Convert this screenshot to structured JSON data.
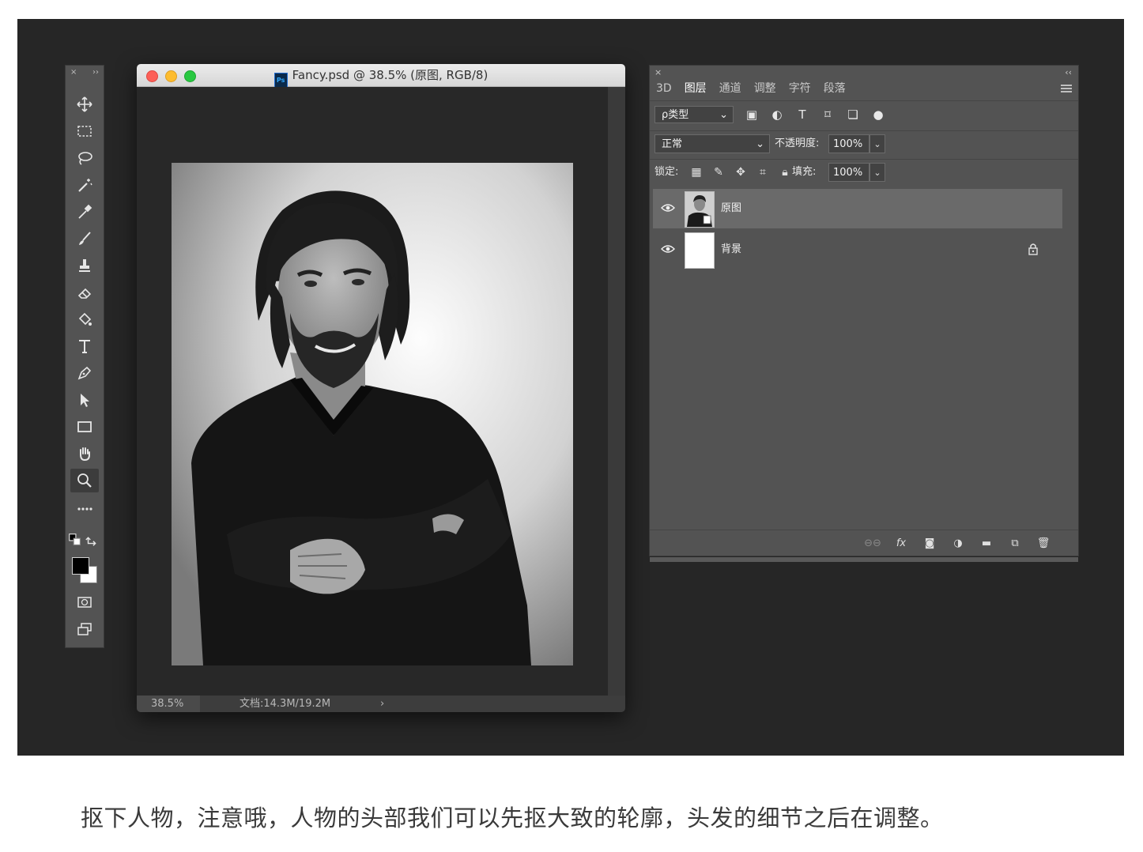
{
  "document": {
    "title": "Fancy.psd @ 38.5% (原图, RGB/8)",
    "zoom": "38.5%",
    "doc_info": "文档:14.3M/19.2M",
    "status_arrow": "›"
  },
  "tools_panel": {
    "header_close": "×",
    "header_collapse": "››",
    "tools": [
      "move-tool",
      "marquee-tool",
      "lasso-tool",
      "magic-wand-tool",
      "eyedropper-tool",
      "brush-tool",
      "stamp-tool",
      "eraser-tool",
      "paint-bucket-tool",
      "type-tool",
      "pen-tool",
      "path-select-tool",
      "rectangle-tool",
      "hand-tool",
      "zoom-tool",
      "more-tools"
    ],
    "foreground_color": "#000000",
    "background_color": "#ffffff"
  },
  "layers_panel": {
    "header_close": "×",
    "header_collapse": "‹‹",
    "tabs": [
      "3D",
      "图层",
      "通道",
      "调整",
      "字符",
      "段落"
    ],
    "active_tab": "图层",
    "filter": {
      "label": "ρ类型",
      "chevron": "⌄"
    },
    "blend_mode": "正常",
    "opacity_label": "不透明度:",
    "opacity_value": "100%",
    "lock_label": "锁定:",
    "fill_label": "填充:",
    "fill_value": "100%",
    "layers": [
      {
        "name": "原图",
        "visible": true,
        "selected": true
      },
      {
        "name": "背景",
        "visible": true,
        "locked": true
      }
    ]
  },
  "caption": "抠下人物，注意哦，人物的头部我们可以先抠大致的轮廓，头发的细节之后在调整。"
}
